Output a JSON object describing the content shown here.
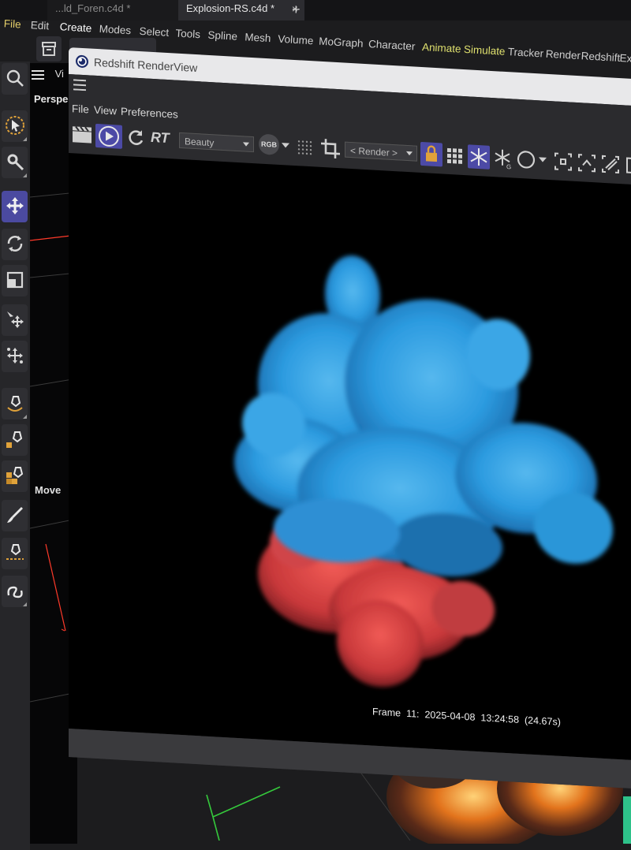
{
  "tabs": {
    "inactive": "...ld_Foren.c4d *",
    "active": "Explosion-RS.c4d *",
    "close": "×",
    "add": "+"
  },
  "menubar": [
    "File",
    "Edit",
    "Create",
    "Modes",
    "Select",
    "Tools",
    "Spline",
    "Mesh",
    "Volume",
    "MoGraph",
    "Character",
    "Animate",
    "Simulate",
    "Tracker",
    "Render",
    "Redshift",
    "Exten"
  ],
  "viewport": {
    "view_menu": "Vi",
    "camera": "Perspec",
    "mode_label": "Move"
  },
  "renderview": {
    "title": "Redshift RenderView",
    "menu": [
      "File",
      "View",
      "Preferences"
    ],
    "rt_label": "RT",
    "aov_value": "Beauty",
    "rgb_label": "RGB",
    "render_value": "< Render >",
    "status": {
      "frame_label": "Frame",
      "frame_number": "11:",
      "date": "2025-04-08",
      "time": "13:24:58",
      "duration": "(24.67s)"
    }
  },
  "colors": {
    "accent_selected": "#4b4aa0",
    "smoke_blue": "#3aa6e6",
    "smoke_red": "#e8494a",
    "menu_highlight": "#e5cf6a"
  },
  "icons": [
    "search-icon",
    "select-cursor-icon",
    "gear-tools-icon",
    "move-icon",
    "rotate-icon",
    "scale-icon",
    "move-child-icon",
    "distribute-icon",
    "pen-icon",
    "spline-pen-icon",
    "polygon-pen-icon",
    "brush-icon",
    "sketch-pen-icon",
    "spline-draw-icon",
    "clapper-icon",
    "play-icon",
    "refresh-icon",
    "crop-icon",
    "lock-icon",
    "grid-icon",
    "snowflake-icon",
    "snowflake-g-icon",
    "circle-icon"
  ]
}
